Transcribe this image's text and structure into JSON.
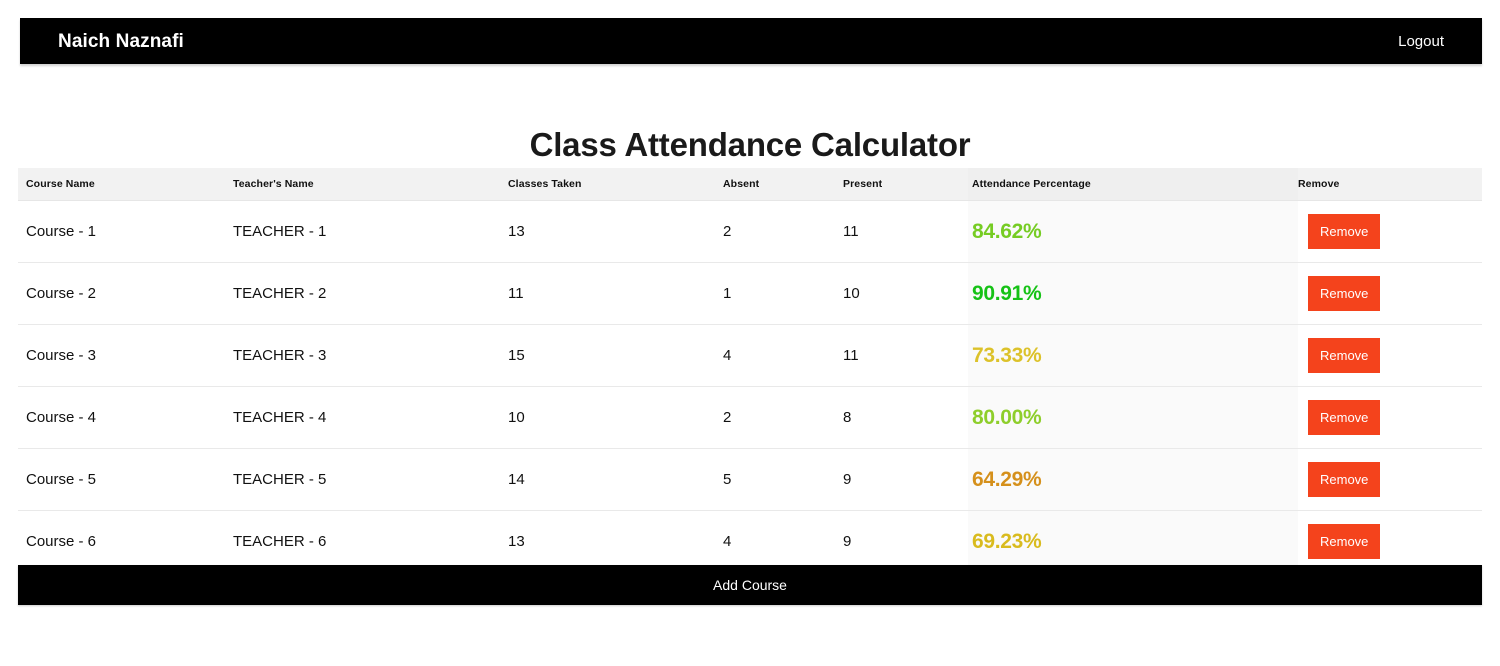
{
  "navbar": {
    "brand": "Naich Naznafi",
    "logout_label": "Logout"
  },
  "page_title": "Class Attendance Calculator",
  "table": {
    "headers": {
      "course": "Course Name",
      "teacher": "Teacher's Name",
      "taken": "Classes Taken",
      "absent": "Absent",
      "present": "Present",
      "percentage": "Attendance Percentage",
      "remove": "Remove"
    },
    "rows": [
      {
        "course": "Course - 1",
        "teacher": "TEACHER - 1",
        "taken": "13",
        "absent": "2",
        "present": "11",
        "percentage": "84.62%",
        "percentage_color": "#76cc23",
        "remove_label": "Remove"
      },
      {
        "course": "Course - 2",
        "teacher": "TEACHER - 2",
        "taken": "11",
        "absent": "1",
        "present": "10",
        "percentage": "90.91%",
        "percentage_color": "#16c216",
        "remove_label": "Remove"
      },
      {
        "course": "Course - 3",
        "teacher": "TEACHER - 3",
        "taken": "15",
        "absent": "4",
        "present": "11",
        "percentage": "73.33%",
        "percentage_color": "#dcc22a",
        "remove_label": "Remove"
      },
      {
        "course": "Course - 4",
        "teacher": "TEACHER - 4",
        "taken": "10",
        "absent": "2",
        "present": "8",
        "percentage": "80.00%",
        "percentage_color": "#8ece2b",
        "remove_label": "Remove"
      },
      {
        "course": "Course - 5",
        "teacher": "TEACHER - 5",
        "taken": "14",
        "absent": "5",
        "present": "9",
        "percentage": "64.29%",
        "percentage_color": "#d5901b",
        "remove_label": "Remove"
      },
      {
        "course": "Course - 6",
        "teacher": "TEACHER - 6",
        "taken": "13",
        "absent": "4",
        "present": "9",
        "percentage": "69.23%",
        "percentage_color": "#d9bb1e",
        "remove_label": "Remove"
      }
    ]
  },
  "footer": {
    "add_course_label": "Add Course"
  },
  "colors": {
    "navbar_bg": "#000000",
    "remove_button": "#f4431c",
    "header_row_bg": "#f2f2f2",
    "percentage_column_bg": "#fafafa"
  }
}
